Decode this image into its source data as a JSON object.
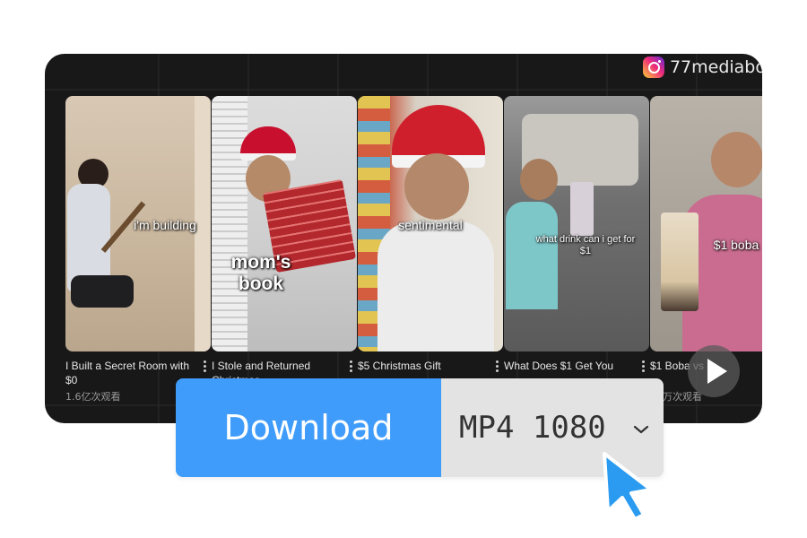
{
  "watermark": {
    "icon": "instagram-icon",
    "handle": "77mediabo"
  },
  "videos": [
    {
      "overlay": "i'm building",
      "title": "I Built a Secret Room with $0",
      "views": "1.6亿次观看"
    },
    {
      "overlay": "mom's book",
      "title": "I Stole and Returned Christmas",
      "views": ""
    },
    {
      "overlay": "sentimental",
      "title": "$5 Christmas Gift",
      "views": ""
    },
    {
      "overlay": "what drink can i get for $1",
      "title": "What Does $1 Get You",
      "views": ""
    },
    {
      "overlay": "$1 boba",
      "title": "$1 Boba vs $",
      "views": "63万次观看"
    }
  ],
  "download": {
    "label": "Download",
    "format": "MP4 1080"
  },
  "colors": {
    "accent": "#3f9cfb",
    "cursor": "#2a9bf0"
  }
}
